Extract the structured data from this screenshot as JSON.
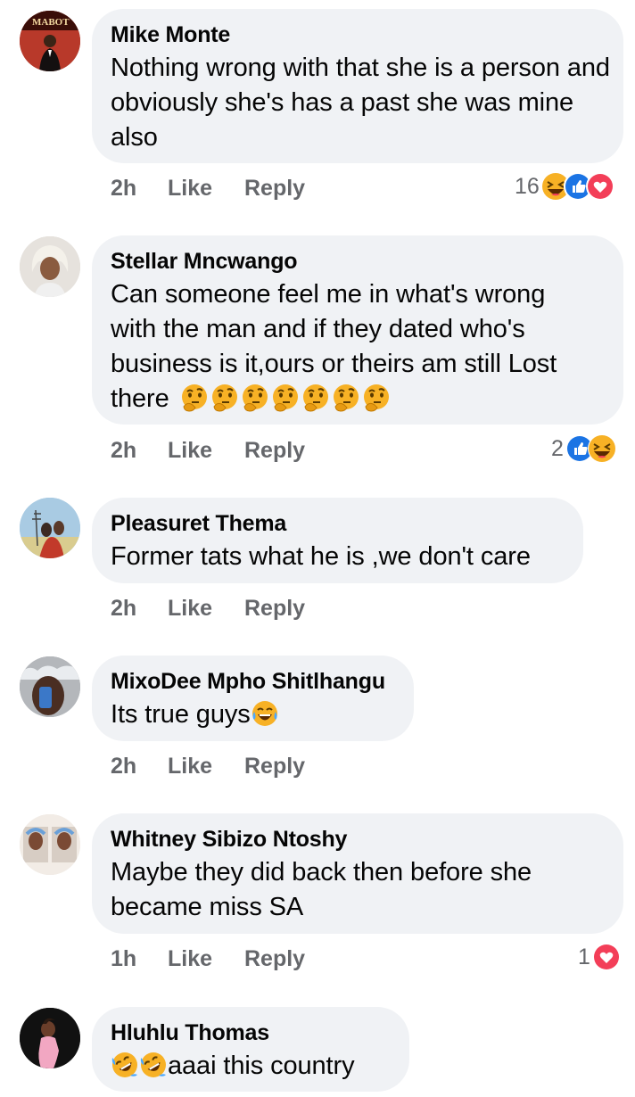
{
  "comments": [
    {
      "name": "Mike Monte",
      "text": "Nothing wrong with that she is a person and  obviously she's has a past she was mine also",
      "time": "2h",
      "like_label": "Like",
      "reply_label": "Reply",
      "reaction_count": "16",
      "reactions": [
        "haha-icon",
        "like-icon",
        "love-icon"
      ],
      "avatar_text": "MABOT"
    },
    {
      "name": "Stellar Mncwango",
      "text_lines": [
        "Can someone feel me in what's wrong",
        "with the man and if they dated who's",
        "business is it,ours or theirs am still Lost"
      ],
      "text_last": "there",
      "emoji_count": 7,
      "emoji_name": "thinking-face-icon",
      "time": "2h",
      "like_label": "Like",
      "reply_label": "Reply",
      "reaction_count": "2",
      "reactions": [
        "like-icon",
        "haha-icon"
      ]
    },
    {
      "name": "Pleasuret Thema",
      "text": "Former tats what he is ,we don't care",
      "time": "2h",
      "like_label": "Like",
      "reply_label": "Reply"
    },
    {
      "name": "MixoDee Mpho Shitlhangu",
      "text": "Its true guys",
      "emoji_name": "laughing-tears-icon",
      "time": "2h",
      "like_label": "Like",
      "reply_label": "Reply"
    },
    {
      "name": "Whitney Sibizo Ntoshy",
      "text_lines": [
        "Maybe they did back then before she",
        "became miss SA"
      ],
      "time": "1h",
      "like_label": "Like",
      "reply_label": "Reply",
      "reaction_count": "1",
      "reactions": [
        "love-icon"
      ]
    },
    {
      "name": "Hluhlu Thomas",
      "text": "aaai this country",
      "emoji_name": "rolling-laughing-icon",
      "emoji_count": 2
    }
  ],
  "colors": {
    "bubble": "#f0f2f5",
    "meta_text": "#65676b",
    "like_blue": "#1b74e4",
    "love_red": "#f33e58",
    "haha_yellow": "#f7b125"
  }
}
